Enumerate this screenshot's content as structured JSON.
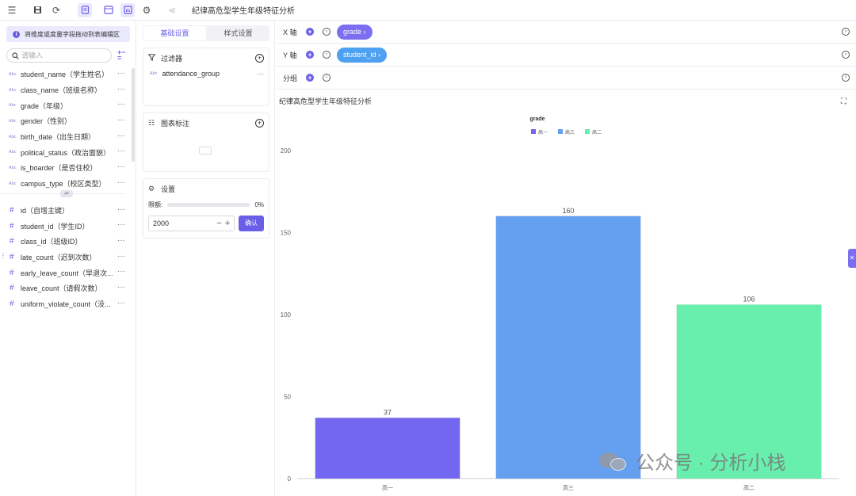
{
  "toolbar": {
    "title": "纪律高危型学生年级特征分析",
    "icons": [
      "outdent-icon",
      "save-icon",
      "refresh-icon",
      "document-icon",
      "table-settings-icon",
      "chart-icon",
      "settings-icon",
      "share-icon"
    ]
  },
  "fields_panel": {
    "hint": "将维度或度量字段拖动到表编辑区",
    "search_placeholder": "请输入",
    "dimensions": [
      {
        "type": "Abc",
        "label": "student_name（学生姓名）"
      },
      {
        "type": "Abc",
        "label": "class_name（班级名称）"
      },
      {
        "type": "Abc",
        "label": "grade（年级）"
      },
      {
        "type": "Abc",
        "label": "gender（性别）"
      },
      {
        "type": "Abc",
        "label": "birth_date（出生日期）"
      },
      {
        "type": "Abc",
        "label": "political_status（政治面貌）"
      },
      {
        "type": "Abc",
        "label": "is_boarder（是否住校）"
      },
      {
        "type": "Abc",
        "label": "campus_type（校区类型）"
      }
    ],
    "divider_label": "⇌",
    "measures": [
      {
        "type": "#",
        "label": "id（自增主键）"
      },
      {
        "type": "#",
        "label": "student_id（学生ID）"
      },
      {
        "type": "#",
        "label": "class_id（班级ID）"
      },
      {
        "type": "#",
        "label": "late_count（迟到次数）"
      },
      {
        "type": "#",
        "label": "early_leave_count（早退次..."
      },
      {
        "type": "#",
        "label": "leave_count（请假次数）"
      },
      {
        "type": "#",
        "label": "uniform_violate_count（没..."
      }
    ],
    "more": "···"
  },
  "config_panel": {
    "tabs": [
      "基础设置",
      "样式设置"
    ],
    "filter": {
      "title": "过滤器",
      "item_type": "Abc",
      "item": "attendance_group"
    },
    "annotation": {
      "title": "图表标注"
    },
    "settings": {
      "title": "设置",
      "limit_label": "限额:",
      "limit_percent": "0%",
      "limit_fraction": 0,
      "limit_value": "2000",
      "confirm": "确认"
    }
  },
  "axes": {
    "x": {
      "label": "X 轴",
      "pill": "grade ›"
    },
    "y": {
      "label": "Y 轴",
      "pill": "student_id ›"
    },
    "group": {
      "label": "分组"
    }
  },
  "chart_title": "纪律高危型学生年级特征分析",
  "chart_data": {
    "type": "bar",
    "title": "grade",
    "categories": [
      "高一",
      "高三",
      "高二"
    ],
    "values": [
      37,
      160,
      106
    ],
    "colors": [
      "#7366f0",
      "#659ff0",
      "#68efae"
    ],
    "legend": [
      "高一",
      "高三",
      "高二"
    ],
    "legend_position": "top-center",
    "ylim": [
      0,
      200
    ],
    "yticks": [
      0,
      50,
      100,
      150,
      200
    ],
    "grid": false
  },
  "watermark": "公众号 · 分析小栈",
  "colors": {
    "accent": "#6a5ee8",
    "pill_x": "#7b6ef0",
    "pill_y": "#4ea0f0"
  }
}
